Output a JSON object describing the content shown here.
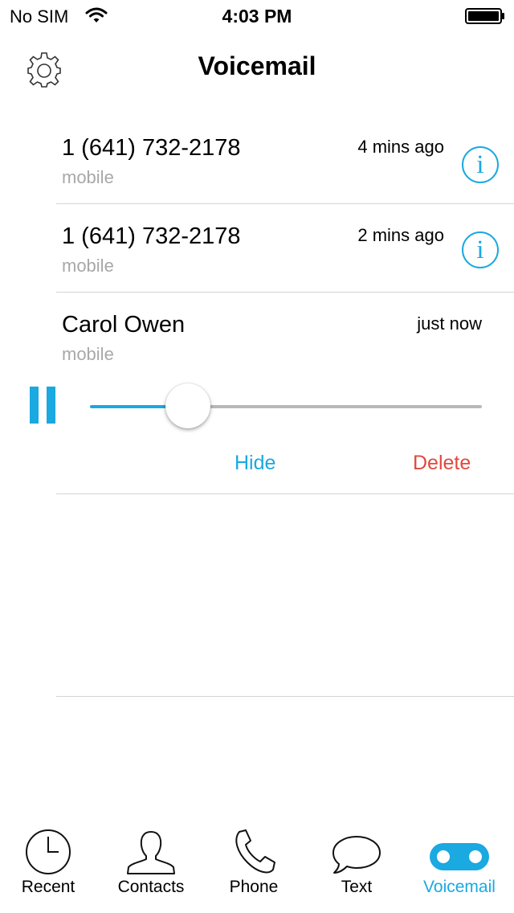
{
  "status_bar": {
    "carrier": "No SIM",
    "time": "4:03 PM"
  },
  "nav": {
    "title": "Voicemail",
    "left_icon": "gear-icon"
  },
  "voicemails": [
    {
      "name": "1 (641) 732-2178",
      "type": "mobile",
      "time": "4 mins ago",
      "info_glyph": "i"
    },
    {
      "name": "1 (641) 732-2178",
      "type": "mobile",
      "time": "2 mins ago",
      "info_glyph": "i"
    },
    {
      "name": "Carol Owen",
      "type": "mobile",
      "time": "just now"
    }
  ],
  "player": {
    "progress": 0.25,
    "hide_label": "Hide",
    "delete_label": "Delete",
    "pause_icon": "pause-icon"
  },
  "tabs": [
    {
      "label": "Recent",
      "icon": "clock-icon",
      "active": false
    },
    {
      "label": "Contacts",
      "icon": "contacts-icon",
      "active": false
    },
    {
      "label": "Phone",
      "icon": "phone-icon",
      "active": false
    },
    {
      "label": "Text",
      "icon": "chat-bubble-icon",
      "active": false
    },
    {
      "label": "Voicemail",
      "icon": "voicemail-icon",
      "active": true
    }
  ],
  "colors": {
    "accent": "#1aa9e0",
    "destructive": "#e04a3f",
    "secondary_text": "#a8a8a8",
    "divider": "#d4d4d4"
  }
}
